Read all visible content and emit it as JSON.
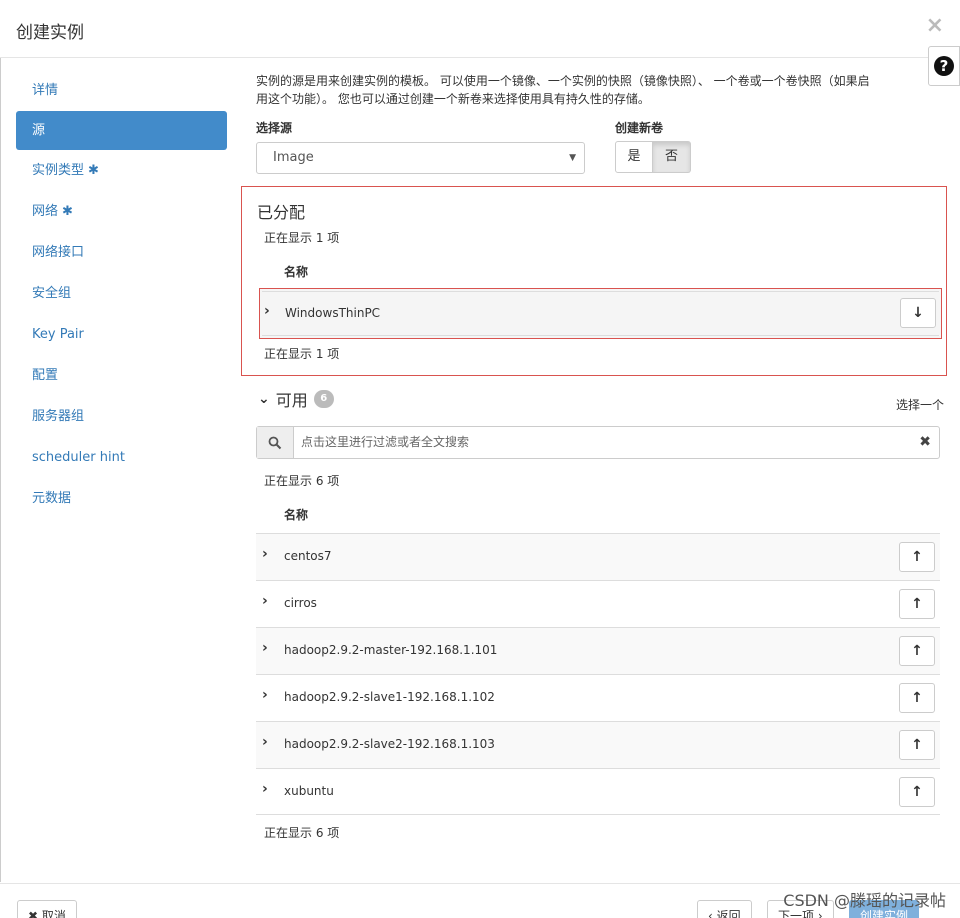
{
  "modal": {
    "title": "创建实例",
    "close_glyph": "×",
    "help_glyph": "?"
  },
  "sidebar": {
    "items": [
      {
        "label": "详情",
        "required": false
      },
      {
        "label": "源",
        "required": false
      },
      {
        "label": "实例类型",
        "required": true
      },
      {
        "label": "网络",
        "required": true
      },
      {
        "label": "网络接口",
        "required": false
      },
      {
        "label": "安全组",
        "required": false
      },
      {
        "label": "Key Pair",
        "required": false
      },
      {
        "label": "配置",
        "required": false
      },
      {
        "label": "服务器组",
        "required": false
      },
      {
        "label": "scheduler hint",
        "required": false
      },
      {
        "label": "元数据",
        "required": false
      }
    ],
    "active_index": 1,
    "required_mark": "✱"
  },
  "source": {
    "intro_line1": "实例的源是用来创建实例的模板。 可以使用一个镜像、一个实例的快照（镜像快照）、 一个卷或一个卷快照（如果启",
    "intro_line2": "用这个功能）。 您也可以通过创建一个新卷来选择使用具有持久性的存储。",
    "select_label": "选择源",
    "select_value": "Image",
    "new_volume_label": "创建新卷",
    "toggle_yes": "是",
    "toggle_no": "否"
  },
  "allocated": {
    "title": "已分配",
    "count_text": "正在显示 1 项",
    "column_name": "名称",
    "rows": [
      {
        "name": "WindowsThinPC"
      }
    ]
  },
  "available": {
    "title": "可用",
    "badge": "6",
    "pick_one": "选择一个",
    "search_placeholder": "点击这里进行过滤或者全文搜索",
    "count_text": "正在显示 6 项",
    "column_name": "名称",
    "rows": [
      {
        "name": "centos7"
      },
      {
        "name": "cirros"
      },
      {
        "name": "hadoop2.9.2-master-192.168.1.101"
      },
      {
        "name": "hadoop2.9.2-slave1-192.168.1.102"
      },
      {
        "name": "hadoop2.9.2-slave2-192.168.1.103"
      },
      {
        "name": "xubuntu"
      }
    ]
  },
  "icons": {
    "expand": "chevron-right-icon",
    "move_down": "arrow-down-icon",
    "move_up": "arrow-up-icon",
    "search": "search-icon",
    "clear": "times-icon"
  },
  "colors": {
    "accent": "#428bca",
    "link": "#337ab7",
    "highlight_border": "#d9534f"
  },
  "footer": {
    "cancel_label": "✖ 取消",
    "back_label": "‹ 返回",
    "next_label": "下一项 ›",
    "launch_label": "创建实例",
    "watermark": "CSDN @滕瑶的记录帖"
  }
}
